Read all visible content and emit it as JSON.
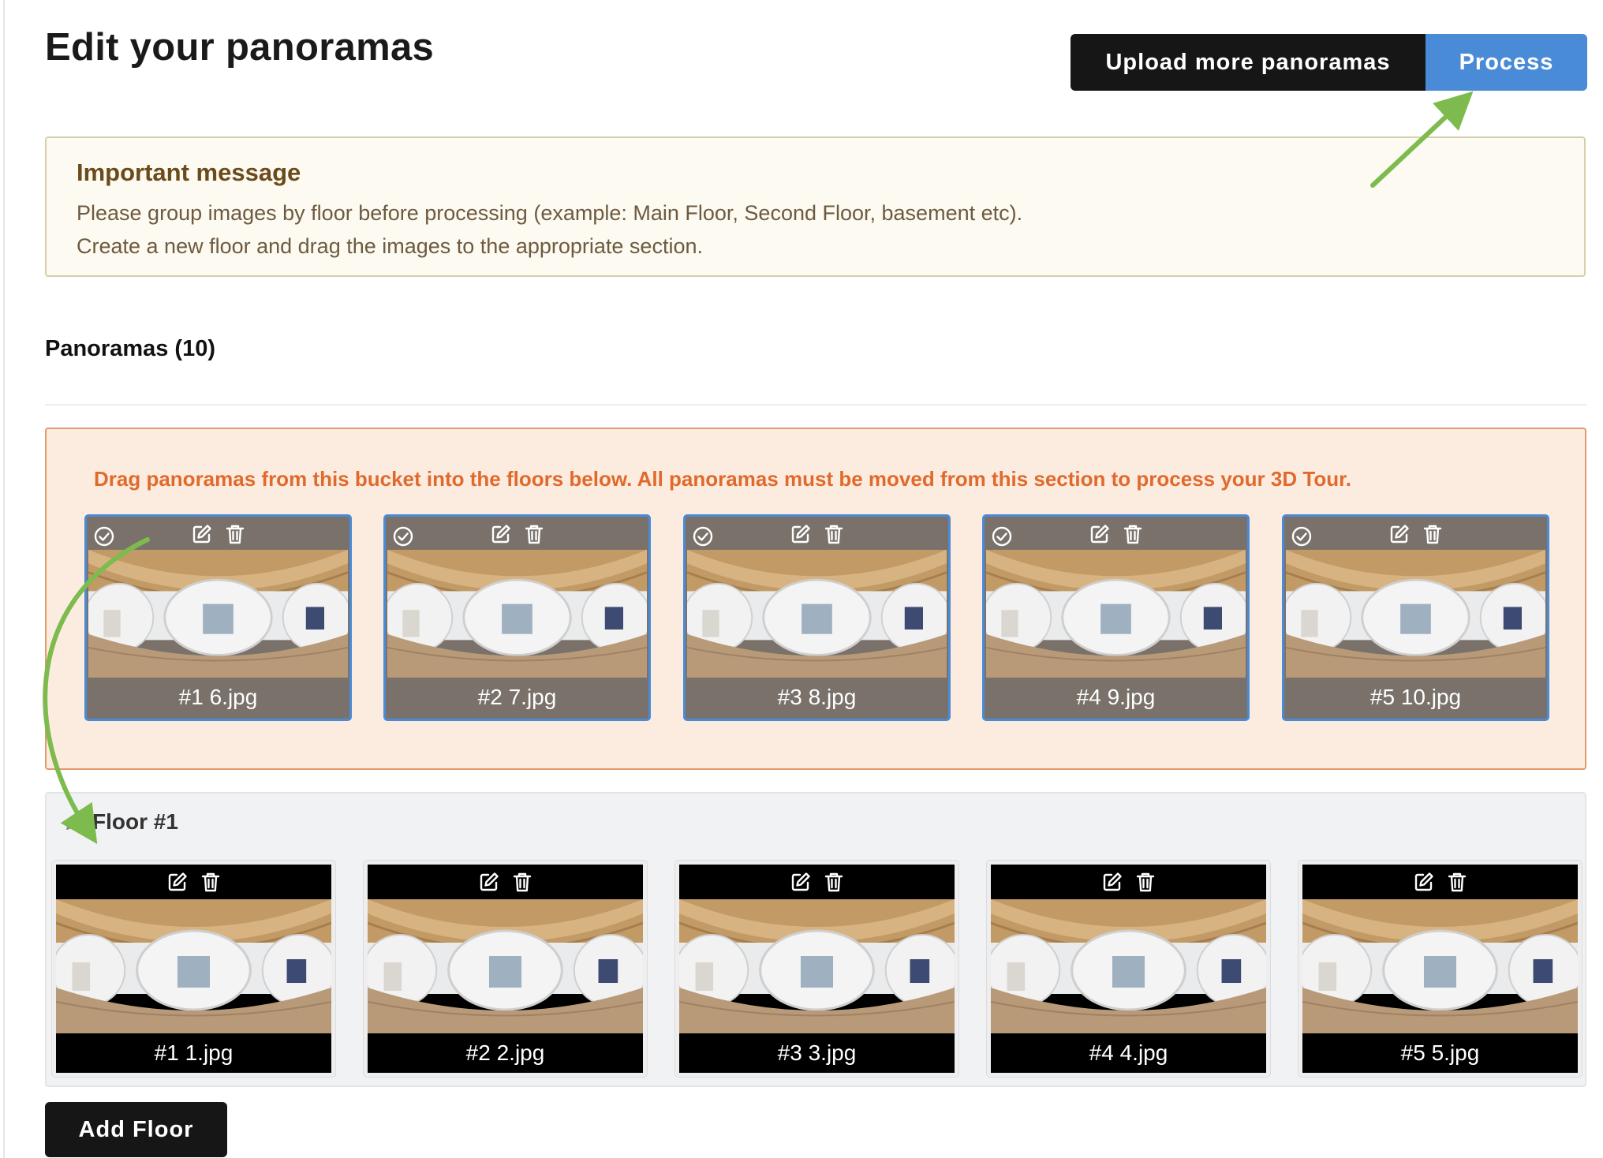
{
  "page": {
    "title": "Edit your panoramas"
  },
  "toolbar": {
    "upload_label": "Upload more panoramas",
    "process_label": "Process"
  },
  "message": {
    "title": "Important message",
    "line1": "Please group images by floor before processing (example: Main Floor, Second Floor, basement etc).",
    "line2": "Create a new floor and drag the images to the appropriate section."
  },
  "section": {
    "title": "Panoramas (10)"
  },
  "bucket": {
    "instructions": "Drag panoramas from this bucket into the floors below. All panoramas must be moved from this section to process your 3D Tour.",
    "items": [
      {
        "label": "#1 6.jpg"
      },
      {
        "label": "#2 7.jpg"
      },
      {
        "label": "#3 8.jpg"
      },
      {
        "label": "#4 9.jpg"
      },
      {
        "label": "#5 10.jpg"
      }
    ]
  },
  "floor": {
    "title": "Floor #1",
    "items": [
      {
        "label": "#1 1.jpg"
      },
      {
        "label": "#2 2.jpg"
      },
      {
        "label": "#3 3.jpg"
      },
      {
        "label": "#4 4.jpg"
      },
      {
        "label": "#5 5.jpg"
      }
    ]
  },
  "add_floor": {
    "label": "Add Floor"
  },
  "icons": {
    "edit": "edit-icon",
    "delete": "trash-icon",
    "select": "check-circle-icon",
    "rename": "pencil-icon"
  },
  "colors": {
    "accent": "#4a8bd7",
    "bucket_bg": "#fcece0",
    "bucket_border": "#e39a6b",
    "bucket_text": "#e06a2c",
    "annotation_arrow": "#7dbb4e"
  }
}
